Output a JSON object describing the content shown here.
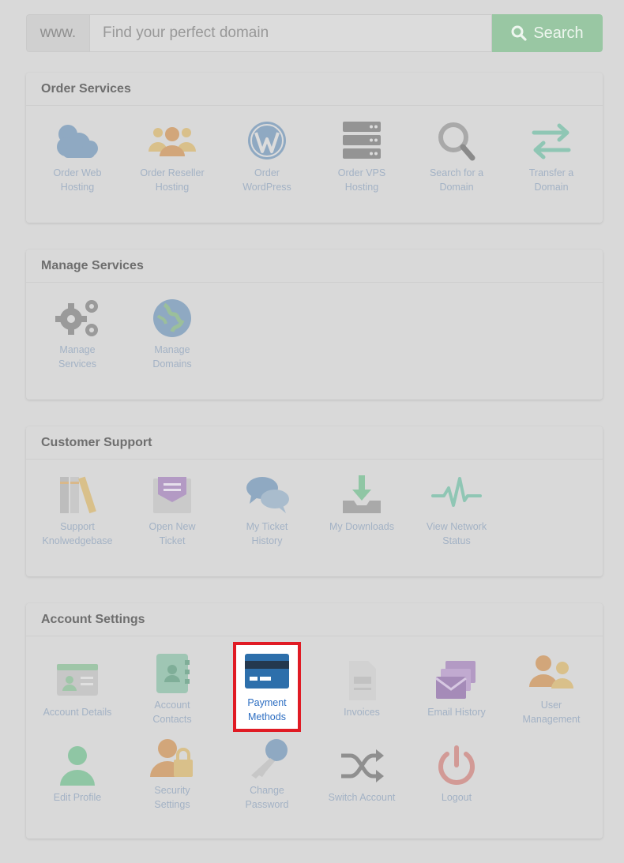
{
  "search": {
    "prefix": "www.",
    "placeholder": "Find your perfect domain",
    "button_label": "Search"
  },
  "sections": {
    "order": {
      "title": "Order Services",
      "items": [
        {
          "label_1": "Order Web",
          "label_2": "Hosting",
          "icon": "cloud-icon"
        },
        {
          "label_1": "Order Reseller",
          "label_2": "Hosting",
          "icon": "users-group-icon"
        },
        {
          "label_1": "Order",
          "label_2": "WordPress",
          "icon": "wordpress-icon"
        },
        {
          "label_1": "Order VPS",
          "label_2": "Hosting",
          "icon": "server-icon"
        },
        {
          "label_1": "Search for a",
          "label_2": "Domain",
          "icon": "magnifier-icon"
        },
        {
          "label_1": "Transfer a",
          "label_2": "Domain",
          "icon": "transfer-arrows-icon"
        }
      ]
    },
    "manage": {
      "title": "Manage Services",
      "items": [
        {
          "label_1": "Manage",
          "label_2": "Services",
          "icon": "gears-icon"
        },
        {
          "label_1": "Manage",
          "label_2": "Domains",
          "icon": "globe-icon"
        }
      ]
    },
    "support": {
      "title": "Customer Support",
      "items": [
        {
          "label_1": "Support",
          "label_2": "Knolwedgebase",
          "icon": "books-icon"
        },
        {
          "label_1": "Open New",
          "label_2": "Ticket",
          "icon": "envelope-ticket-icon"
        },
        {
          "label_1": "My Ticket",
          "label_2": "History",
          "icon": "chat-bubbles-icon"
        },
        {
          "label_1": "My Downloads",
          "icon": "download-tray-icon"
        },
        {
          "label_1": "View Network",
          "label_2": "Status",
          "icon": "pulse-icon"
        }
      ]
    },
    "account": {
      "title": "Account Settings",
      "items": [
        {
          "label_1": "Account Details",
          "icon": "id-card-icon"
        },
        {
          "label_1": "Account",
          "label_2": "Contacts",
          "icon": "address-book-icon"
        },
        {
          "label_1": "Payment",
          "label_2": "Methods",
          "icon": "credit-card-icon"
        },
        {
          "label_1": "Invoices",
          "icon": "invoice-icon"
        },
        {
          "label_1": "Email History",
          "icon": "email-stack-icon"
        },
        {
          "label_1": "User",
          "label_2": "Management",
          "icon": "users-icon"
        },
        {
          "label_1": "Edit Profile",
          "icon": "user-icon"
        },
        {
          "label_1": "Security",
          "label_2": "Settings",
          "icon": "user-lock-icon"
        },
        {
          "label_1": "Change",
          "label_2": "Password",
          "icon": "key-icon"
        },
        {
          "label_1": "Switch Account",
          "icon": "shuffle-icon"
        },
        {
          "label_1": "Logout",
          "icon": "power-icon"
        }
      ]
    }
  },
  "colors": {
    "overlay_bg": "#d9d9d9",
    "search_button": "#99c7a3",
    "highlight_border": "#e01b24",
    "label_muted": "#a3b2c5",
    "label_active": "#2d6ec2"
  }
}
